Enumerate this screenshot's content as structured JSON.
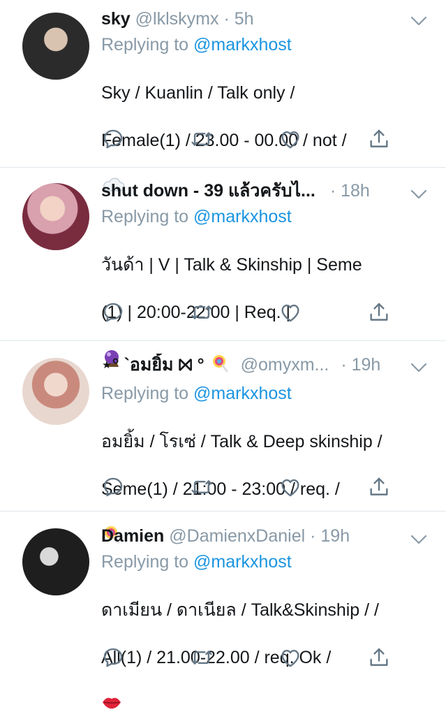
{
  "tweets": [
    {
      "name": "sky",
      "handle": "@lklskymx",
      "dot": "·",
      "time": "5h",
      "reply_prefix": "Replying to",
      "reply_to": "@markxhost",
      "line1": "Sky / Kuanlin / Talk only /",
      "line2": "Female(1) / 23.00 - 00.00 / not /",
      "emoji_icon": "cloud-emoji",
      "avatar_color": "#2b2b2b"
    },
    {
      "name": "shut down - 39 แล้วครับไ...",
      "handle": "",
      "dot": "·",
      "time": "18h",
      "reply_prefix": "Replying to",
      "reply_to": "@markxhost",
      "line1": "วันด้า | V | Talk & Skinship | Seme",
      "line2": "(1) | 20:00-22:00 | Req. |",
      "emoji_icon": "crystal-ball-emoji",
      "avatar_color": "#b0556b"
    },
    {
      "name": "⋆° `อมยิ้ม ⨝ °",
      "handle": "@omyxm...",
      "dot": "·",
      "time": "19h",
      "reply_prefix": "Replying to",
      "reply_to": "@markxhost",
      "line1": "อมยิ้ม / โรเซ่ / Talk & Deep skinship /",
      "line2": "Seme(1) / 21:00 - 23:00 / req. /",
      "emoji_icon": "lollipop-emoji",
      "avatar_color": "#c9a89a"
    },
    {
      "name": "Damien",
      "handle": "@DamienxDaniel",
      "dot": "·",
      "time": "19h",
      "reply_prefix": "Replying to",
      "reply_to": "@markxhost",
      "line1": "ดาเมียน / ดาเนียล / Talk&Skinship / /",
      "line2": "All(1) / 21.00-22.00 / req. Ok /",
      "emoji_icon": "kiss-mark-emoji",
      "avatar_color": "#1e1e1e"
    }
  ],
  "colors": {
    "accent": "#1b95e0",
    "muted": "#8899a6",
    "text": "#14171a",
    "divider": "#e1e8ed"
  },
  "action_icons": [
    "reply-icon",
    "retweet-icon",
    "like-icon",
    "share-icon"
  ]
}
